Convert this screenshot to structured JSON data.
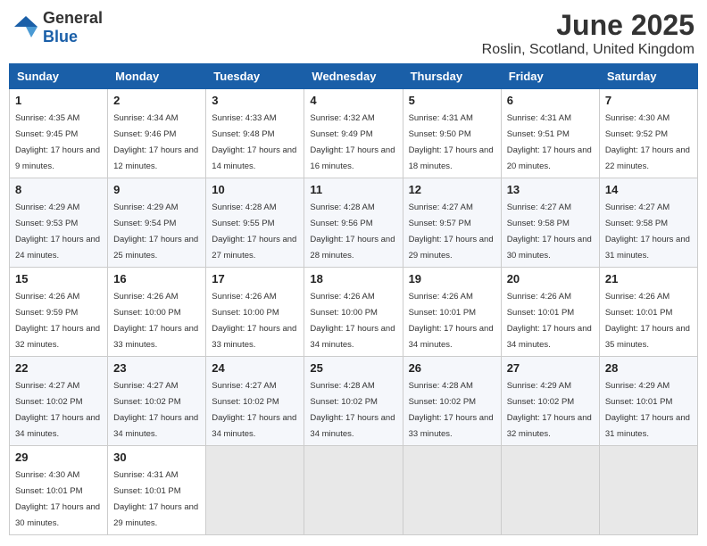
{
  "logo": {
    "general": "General",
    "blue": "Blue"
  },
  "header": {
    "month": "June 2025",
    "location": "Roslin, Scotland, United Kingdom"
  },
  "weekdays": [
    "Sunday",
    "Monday",
    "Tuesday",
    "Wednesday",
    "Thursday",
    "Friday",
    "Saturday"
  ],
  "weeks": [
    [
      {
        "day": "1",
        "sunrise": "4:35 AM",
        "sunset": "9:45 PM",
        "daylight": "17 hours and 9 minutes."
      },
      {
        "day": "2",
        "sunrise": "4:34 AM",
        "sunset": "9:46 PM",
        "daylight": "17 hours and 12 minutes."
      },
      {
        "day": "3",
        "sunrise": "4:33 AM",
        "sunset": "9:48 PM",
        "daylight": "17 hours and 14 minutes."
      },
      {
        "day": "4",
        "sunrise": "4:32 AM",
        "sunset": "9:49 PM",
        "daylight": "17 hours and 16 minutes."
      },
      {
        "day": "5",
        "sunrise": "4:31 AM",
        "sunset": "9:50 PM",
        "daylight": "17 hours and 18 minutes."
      },
      {
        "day": "6",
        "sunrise": "4:31 AM",
        "sunset": "9:51 PM",
        "daylight": "17 hours and 20 minutes."
      },
      {
        "day": "7",
        "sunrise": "4:30 AM",
        "sunset": "9:52 PM",
        "daylight": "17 hours and 22 minutes."
      }
    ],
    [
      {
        "day": "8",
        "sunrise": "4:29 AM",
        "sunset": "9:53 PM",
        "daylight": "17 hours and 24 minutes."
      },
      {
        "day": "9",
        "sunrise": "4:29 AM",
        "sunset": "9:54 PM",
        "daylight": "17 hours and 25 minutes."
      },
      {
        "day": "10",
        "sunrise": "4:28 AM",
        "sunset": "9:55 PM",
        "daylight": "17 hours and 27 minutes."
      },
      {
        "day": "11",
        "sunrise": "4:28 AM",
        "sunset": "9:56 PM",
        "daylight": "17 hours and 28 minutes."
      },
      {
        "day": "12",
        "sunrise": "4:27 AM",
        "sunset": "9:57 PM",
        "daylight": "17 hours and 29 minutes."
      },
      {
        "day": "13",
        "sunrise": "4:27 AM",
        "sunset": "9:58 PM",
        "daylight": "17 hours and 30 minutes."
      },
      {
        "day": "14",
        "sunrise": "4:27 AM",
        "sunset": "9:58 PM",
        "daylight": "17 hours and 31 minutes."
      }
    ],
    [
      {
        "day": "15",
        "sunrise": "4:26 AM",
        "sunset": "9:59 PM",
        "daylight": "17 hours and 32 minutes."
      },
      {
        "day": "16",
        "sunrise": "4:26 AM",
        "sunset": "10:00 PM",
        "daylight": "17 hours and 33 minutes."
      },
      {
        "day": "17",
        "sunrise": "4:26 AM",
        "sunset": "10:00 PM",
        "daylight": "17 hours and 33 minutes."
      },
      {
        "day": "18",
        "sunrise": "4:26 AM",
        "sunset": "10:00 PM",
        "daylight": "17 hours and 34 minutes."
      },
      {
        "day": "19",
        "sunrise": "4:26 AM",
        "sunset": "10:01 PM",
        "daylight": "17 hours and 34 minutes."
      },
      {
        "day": "20",
        "sunrise": "4:26 AM",
        "sunset": "10:01 PM",
        "daylight": "17 hours and 34 minutes."
      },
      {
        "day": "21",
        "sunrise": "4:26 AM",
        "sunset": "10:01 PM",
        "daylight": "17 hours and 35 minutes."
      }
    ],
    [
      {
        "day": "22",
        "sunrise": "4:27 AM",
        "sunset": "10:02 PM",
        "daylight": "17 hours and 34 minutes."
      },
      {
        "day": "23",
        "sunrise": "4:27 AM",
        "sunset": "10:02 PM",
        "daylight": "17 hours and 34 minutes."
      },
      {
        "day": "24",
        "sunrise": "4:27 AM",
        "sunset": "10:02 PM",
        "daylight": "17 hours and 34 minutes."
      },
      {
        "day": "25",
        "sunrise": "4:28 AM",
        "sunset": "10:02 PM",
        "daylight": "17 hours and 34 minutes."
      },
      {
        "day": "26",
        "sunrise": "4:28 AM",
        "sunset": "10:02 PM",
        "daylight": "17 hours and 33 minutes."
      },
      {
        "day": "27",
        "sunrise": "4:29 AM",
        "sunset": "10:02 PM",
        "daylight": "17 hours and 32 minutes."
      },
      {
        "day": "28",
        "sunrise": "4:29 AM",
        "sunset": "10:01 PM",
        "daylight": "17 hours and 31 minutes."
      }
    ],
    [
      {
        "day": "29",
        "sunrise": "4:30 AM",
        "sunset": "10:01 PM",
        "daylight": "17 hours and 30 minutes."
      },
      {
        "day": "30",
        "sunrise": "4:31 AM",
        "sunset": "10:01 PM",
        "daylight": "17 hours and 29 minutes."
      },
      null,
      null,
      null,
      null,
      null
    ]
  ]
}
